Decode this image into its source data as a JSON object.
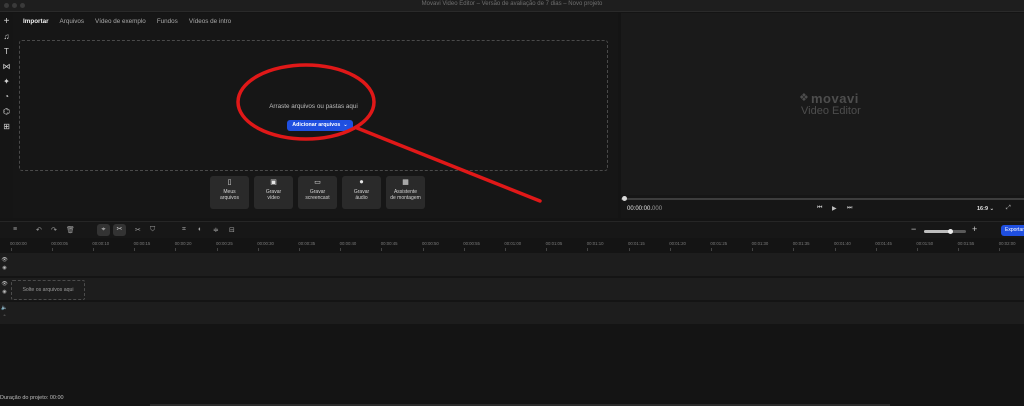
{
  "window": {
    "title": "Movavi Video Editor – Versão de avaliação de 7 dias – Novo projeto"
  },
  "sidebar": {
    "items": [
      {
        "icon": "add-icon",
        "glyph": "+"
      },
      {
        "icon": "music-icon",
        "glyph": "♫"
      },
      {
        "icon": "text-icon",
        "glyph": "T"
      },
      {
        "icon": "transitions-icon",
        "glyph": "⋈"
      },
      {
        "icon": "effects-icon",
        "glyph": "✦"
      },
      {
        "icon": "stickers-icon",
        "glyph": "◔"
      },
      {
        "icon": "tools-icon",
        "glyph": "⌬"
      },
      {
        "icon": "more-icon",
        "glyph": "⊞"
      }
    ]
  },
  "import": {
    "tabs": [
      "Importar",
      "Arquivos",
      "Vídeo de exemplo",
      "Fundos",
      "Vídeos de intro"
    ],
    "drop_text": "Arraste arquivos ou pastas aqui",
    "add_button": "Adicionar arquivos",
    "quick_actions": [
      {
        "icon": "file-icon",
        "glyph": "▯",
        "line1": "Meus",
        "line2": "arquivos"
      },
      {
        "icon": "record-video-icon",
        "glyph": "▣",
        "line1": "Gravar",
        "line2": "vídeo"
      },
      {
        "icon": "screencast-icon",
        "glyph": "▭",
        "line1": "Gravar",
        "line2": "screencast"
      },
      {
        "icon": "microphone-icon",
        "glyph": "⏺",
        "line1": "Gravar",
        "line2": "áudio"
      },
      {
        "icon": "montage-icon",
        "glyph": "▦",
        "line1": "Assistente",
        "line2": "de montagem"
      }
    ]
  },
  "preview": {
    "logo_word": "movavi",
    "logo_sub": "Video Editor",
    "timecode_main": "00:00:00.",
    "timecode_ms": "000",
    "aspect": "16:9",
    "position": 0
  },
  "timeline": {
    "zoom_level": 0.62,
    "export_label": "Exportar",
    "ticks": [
      "00:00:00",
      "00:00:05",
      "00:00:10",
      "00:00:15",
      "00:00:20",
      "00:00:25",
      "00:00:30",
      "00:00:35",
      "00:00:40",
      "00:00:45",
      "00:00:50",
      "00:00:55",
      "00:01:00",
      "00:01:05",
      "00:01:10",
      "00:01:15",
      "00:01:20",
      "00:01:25",
      "00:01:30",
      "00:01:35",
      "00:01:40",
      "00:01:45",
      "00:01:50",
      "00:01:55",
      "00:02:00"
    ],
    "drop_label": "Solte os arquivos aqui",
    "duration": "Duração do projeto: 00:00"
  },
  "colors": {
    "accent": "#1f4fe0",
    "annotation": "#e01818"
  }
}
